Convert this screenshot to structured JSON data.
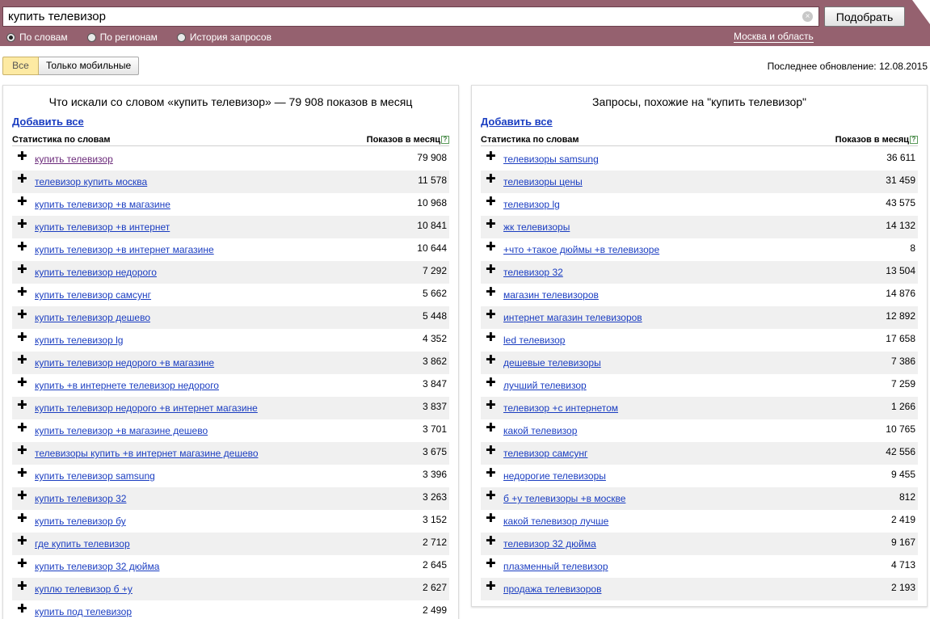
{
  "search": {
    "value": "купить телевизор",
    "clear_icon": "×",
    "submit_label": "Подобрать"
  },
  "modes": [
    {
      "label": "По словам",
      "checked": true
    },
    {
      "label": "По регионам",
      "checked": false
    },
    {
      "label": "История запросов",
      "checked": false
    }
  ],
  "region": "Москва и область",
  "filter": {
    "all": "Все",
    "mobile": "Только мобильные"
  },
  "last_update": "Последнее обновление: 12.08.2015",
  "left_panel": {
    "title": "Что искали со словом «купить телевизор» — 79 908 показов в месяц",
    "add_all": "Добавить все",
    "col_phrase": "Статистика по словам",
    "col_count": "Показов в месяц",
    "help": "?",
    "rows": [
      {
        "phrase": "купить телевизор",
        "count": "79 908"
      },
      {
        "phrase": "телевизор купить москва",
        "count": "11 578"
      },
      {
        "phrase": "купить телевизор +в магазине",
        "count": "10 968"
      },
      {
        "phrase": "купить телевизор +в интернет",
        "count": "10 841"
      },
      {
        "phrase": "купить телевизор +в интернет магазине",
        "count": "10 644"
      },
      {
        "phrase": "купить телевизор недорого",
        "count": "7 292"
      },
      {
        "phrase": "купить телевизор самсунг",
        "count": "5 662"
      },
      {
        "phrase": "купить телевизор дешево",
        "count": "5 448"
      },
      {
        "phrase": "купить телевизор lg",
        "count": "4 352"
      },
      {
        "phrase": "купить телевизор недорого +в магазине",
        "count": "3 862"
      },
      {
        "phrase": "купить +в интернете телевизор недорого",
        "count": "3 847"
      },
      {
        "phrase": "купить телевизор недорого +в интернет магазине",
        "count": "3 837"
      },
      {
        "phrase": "купить телевизор +в магазине дешево",
        "count": "3 701"
      },
      {
        "phrase": "телевизоры купить +в интернет магазине дешево",
        "count": "3 675"
      },
      {
        "phrase": "купить телевизор samsung",
        "count": "3 396"
      },
      {
        "phrase": "купить телевизор 32",
        "count": "3 263"
      },
      {
        "phrase": "купить телевизор бу",
        "count": "3 152"
      },
      {
        "phrase": "где купить телевизор",
        "count": "2 712"
      },
      {
        "phrase": "купить телевизор 32 дюйма",
        "count": "2 645"
      },
      {
        "phrase": "куплю телевизор б +у",
        "count": "2 627"
      },
      {
        "phrase": "купить под телевизор",
        "count": "2 499"
      }
    ]
  },
  "right_panel": {
    "title": "Запросы, похожие на \"купить телевизор\"",
    "add_all": "Добавить все",
    "col_phrase": "Статистика по словам",
    "col_count": "Показов в месяц",
    "help": "?",
    "rows": [
      {
        "phrase": "телевизоры samsung",
        "count": "36 611"
      },
      {
        "phrase": "телевизоры цены",
        "count": "31 459"
      },
      {
        "phrase": "телевизор lg",
        "count": "43 575"
      },
      {
        "phrase": "жк телевизоры",
        "count": "14 132"
      },
      {
        "phrase": "+что +такое дюймы +в телевизоре",
        "count": "8"
      },
      {
        "phrase": "телевизор 32",
        "count": "13 504"
      },
      {
        "phrase": "магазин телевизоров",
        "count": "14 876"
      },
      {
        "phrase": "интернет магазин телевизоров",
        "count": "12 892"
      },
      {
        "phrase": "led телевизор",
        "count": "17 658"
      },
      {
        "phrase": "дешевые телевизоры",
        "count": "7 386"
      },
      {
        "phrase": "лучший телевизор",
        "count": "7 259"
      },
      {
        "phrase": "телевизор +с интернетом",
        "count": "1 266"
      },
      {
        "phrase": "какой телевизор",
        "count": "10 765"
      },
      {
        "phrase": "телевизор самсунг",
        "count": "42 556"
      },
      {
        "phrase": "недорогие телевизоры",
        "count": "9 455"
      },
      {
        "phrase": "б +у телевизоры +в москве",
        "count": "812"
      },
      {
        "phrase": "какой телевизор лучше",
        "count": "2 419"
      },
      {
        "phrase": "телевизор 32 дюйма",
        "count": "9 167"
      },
      {
        "phrase": "плазменный телевизор",
        "count": "4 713"
      },
      {
        "phrase": "продажа телевизоров",
        "count": "2 193"
      }
    ]
  },
  "plus_icon": "✚",
  "colors": {
    "header": "#95616f",
    "link": "#1a3dc1",
    "visited": "#6b2a7a",
    "active_tab": "#fdeaa3"
  }
}
